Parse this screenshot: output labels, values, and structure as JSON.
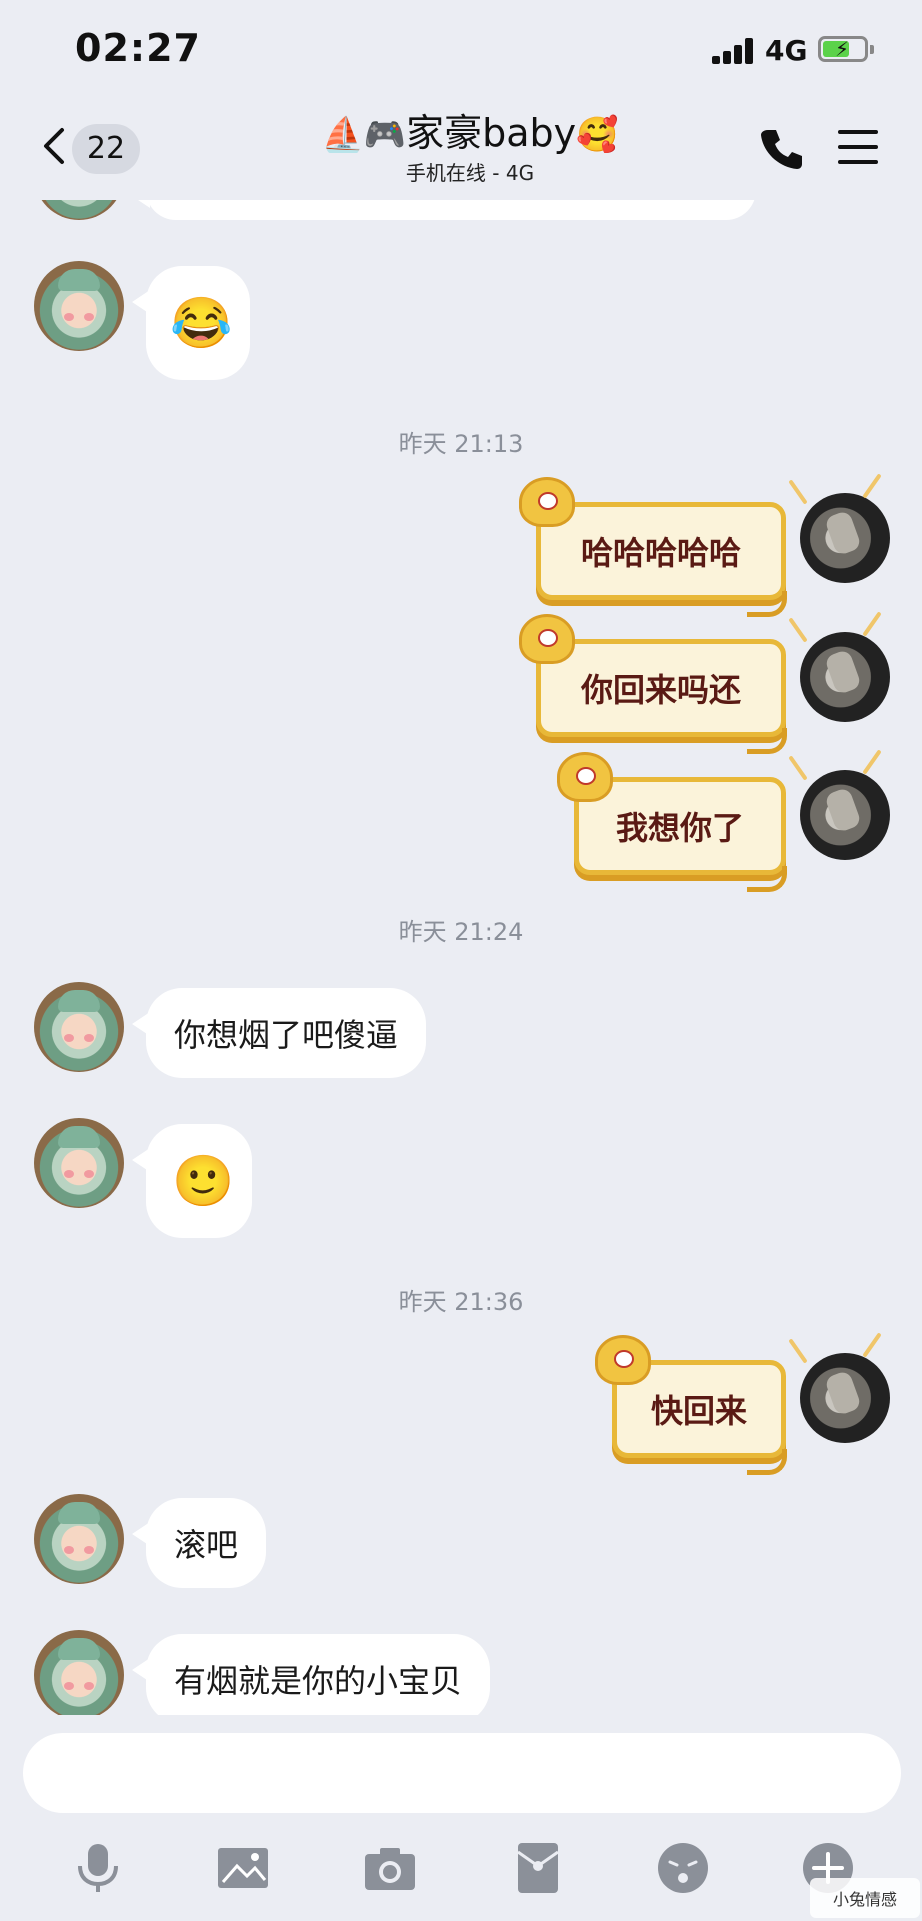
{
  "status_bar": {
    "time": "02:27",
    "network": "4G"
  },
  "header": {
    "back_badge": "22",
    "title_icons": "⛵🎮",
    "title": "家豪baby",
    "title_emoji": "🥰",
    "subtitle": "手机在线 - 4G"
  },
  "messages": {
    "m1_emoji": "😂",
    "ts1": "昨天 21:13",
    "s1": "哈哈哈哈哈",
    "s2": "你回来吗还",
    "s3": "我想你了",
    "ts2": "昨天 21:24",
    "m2": "你想烟了吧傻逼",
    "m3_emoji": "🙂",
    "ts3": "昨天 21:36",
    "s4": "快回来",
    "m4": "滚吧",
    "m5": "有烟就是你的小宝贝"
  },
  "input": {
    "placeholder": ""
  },
  "toolbar": {
    "icons": [
      "microphone-icon",
      "image-icon",
      "camera-icon",
      "red-packet-icon",
      "emoji-icon",
      "plus-icon"
    ]
  },
  "watermark": {
    "text": "小兔情感"
  },
  "colors": {
    "background": "#ebedf3",
    "bubble_accent": "#e8b838",
    "bubble_text": "#5a1a14"
  }
}
